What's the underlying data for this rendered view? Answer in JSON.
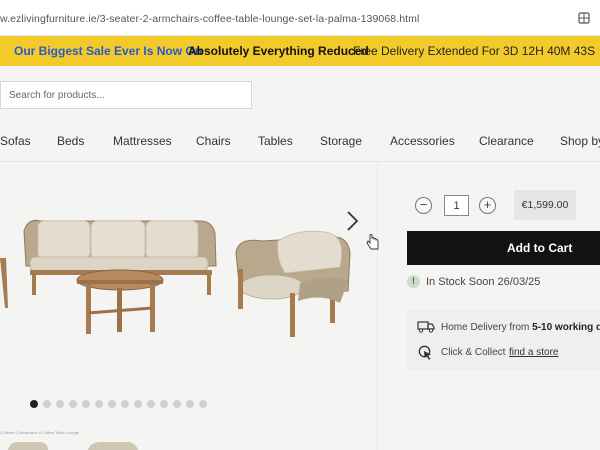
{
  "browser": {
    "url": "w.ezlivingfurniture.ie/3-seater-2-armchairs-coffee-table-lounge-set-la-palma-139068.html",
    "tab_icon": "tab-switcher-icon"
  },
  "promo": {
    "headline": "Our Biggest Sale Ever Is Now On",
    "reduced": "Absolutely Everything Reduced",
    "delivery_countdown": "Free Delivery Extended For 3D 12H 40M 43S",
    "colors": {
      "background": "#f2cb2b",
      "headline": "#2c58c8"
    }
  },
  "search": {
    "placeholder": "Search for products..."
  },
  "nav": {
    "items": [
      "Sofas",
      "Beds",
      "Mattresses",
      "Chairs",
      "Tables",
      "Storage",
      "Accessories",
      "Clearance",
      "Shop by"
    ]
  },
  "gallery": {
    "image": "rope-lounge-set-photo",
    "next_icon": "chevron-right-icon",
    "dot_count": 14,
    "active_dot": 0,
    "caption": "3 Seater 2 Armchairs & Coffee Table Lounge"
  },
  "purchase": {
    "quantity": "1",
    "minus_label": "−",
    "plus_label": "+",
    "price": "€1,599.00",
    "add_to_cart": "Add to Cart",
    "stock_icon_label": "!",
    "stock_text": "In Stock Soon 26/03/25",
    "button_color": "#111214"
  },
  "delivery": {
    "home_prefix": "Home Delivery from",
    "home_days": "5-10 working da",
    "click_collect": "Click & Collect",
    "find_store": "find a store"
  }
}
